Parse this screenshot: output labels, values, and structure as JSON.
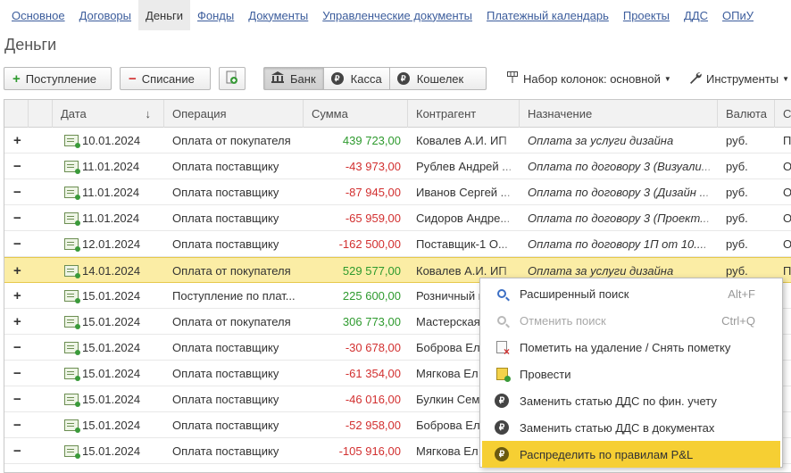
{
  "nav": {
    "items": [
      "Основное",
      "Договоры",
      "Деньги",
      "Фонды",
      "Документы",
      "Управленческие документы",
      "Платежный календарь",
      "Проекты",
      "ДДС",
      "ОПиУ"
    ],
    "active_index": 2
  },
  "page_title": "Деньги",
  "toolbar": {
    "income_label": "Поступление",
    "expense_label": "Списание",
    "bank_label": "Банк",
    "cash_label": "Касса",
    "wallet_label": "Кошелек",
    "columns_label": "Набор колонок: основной",
    "tools_label": "Инструменты",
    "active_source": "Банк"
  },
  "table": {
    "headers": {
      "date": "Дата",
      "operation": "Операция",
      "amount": "Сумма",
      "counterparty": "Контрагент",
      "purpose": "Назначение",
      "currency": "Валюта",
      "status": "Ст"
    },
    "sort_indicator": "↓",
    "rows": [
      {
        "sign": "+",
        "date": "10.01.2024",
        "operation": "Оплата от покупателя",
        "amount": "439 723,00",
        "counterparty": "Ковалев А.И. ИП",
        "purpose": "Оплата за услуги дизайна",
        "currency": "руб.",
        "status": "П"
      },
      {
        "sign": "−",
        "date": "11.01.2024",
        "operation": "Оплата поставщику",
        "amount": "-43 973,00",
        "counterparty": "Рублев Андрей ...",
        "purpose": "Оплата по договору 3 (Визуали...",
        "currency": "руб.",
        "status": "О"
      },
      {
        "sign": "−",
        "date": "11.01.2024",
        "operation": "Оплата поставщику",
        "amount": "-87 945,00",
        "counterparty": "Иванов Сергей ...",
        "purpose": "Оплата по договору 3 (Дизайн ...",
        "currency": "руб.",
        "status": "О"
      },
      {
        "sign": "−",
        "date": "11.01.2024",
        "operation": "Оплата поставщику",
        "amount": "-65 959,00",
        "counterparty": "Сидоров Андре...",
        "purpose": "Оплата по договору 3 (Проект...",
        "currency": "руб.",
        "status": "О"
      },
      {
        "sign": "−",
        "date": "12.01.2024",
        "operation": "Оплата поставщику",
        "amount": "-162 500,00",
        "counterparty": "Поставщик-1 О...",
        "purpose": "Оплата по договору 1П от 10....",
        "currency": "руб.",
        "status": "О"
      },
      {
        "sign": "+",
        "date": "14.01.2024",
        "operation": "Оплата от покупателя",
        "amount": "529 577,00",
        "counterparty": "Ковалев А.И. ИП",
        "purpose": "Оплата за услуги дизайна",
        "currency": "руб.",
        "status": "П"
      },
      {
        "sign": "+",
        "date": "15.01.2024",
        "operation": "Поступление по плат...",
        "amount": "225 600,00",
        "counterparty": "Розничный п",
        "purpose": "",
        "currency": "",
        "status": ""
      },
      {
        "sign": "+",
        "date": "15.01.2024",
        "operation": "Оплата от покупателя",
        "amount": "306 773,00",
        "counterparty": "Мастерская",
        "purpose": "",
        "currency": "",
        "status": ""
      },
      {
        "sign": "−",
        "date": "15.01.2024",
        "operation": "Оплата поставщику",
        "amount": "-30 678,00",
        "counterparty": "Боброва Ел",
        "purpose": "",
        "currency": "",
        "status": ""
      },
      {
        "sign": "−",
        "date": "15.01.2024",
        "operation": "Оплата поставщику",
        "amount": "-61 354,00",
        "counterparty": "Мягкова Ел",
        "purpose": "",
        "currency": "",
        "status": ""
      },
      {
        "sign": "−",
        "date": "15.01.2024",
        "operation": "Оплата поставщику",
        "amount": "-46 016,00",
        "counterparty": "Булкин Сем",
        "purpose": "",
        "currency": "",
        "status": ""
      },
      {
        "sign": "−",
        "date": "15.01.2024",
        "operation": "Оплата поставщику",
        "amount": "-52 958,00",
        "counterparty": "Боброва Ел",
        "purpose": "",
        "currency": "",
        "status": ""
      },
      {
        "sign": "−",
        "date": "15.01.2024",
        "operation": "Оплата поставщику",
        "amount": "-105 916,00",
        "counterparty": "Мягкова Ел",
        "purpose": "",
        "currency": "",
        "status": ""
      }
    ],
    "selected_index": 5
  },
  "context_menu": {
    "items": [
      {
        "label": "Расширенный поиск",
        "shortcut": "Alt+F",
        "icon": "search-icon",
        "disabled": false
      },
      {
        "label": "Отменить поиск",
        "shortcut": "Ctrl+Q",
        "icon": "cancel-search-icon",
        "disabled": true
      },
      {
        "label": "Пометить на удаление / Снять пометку",
        "shortcut": "",
        "icon": "mark-delete-icon",
        "disabled": false
      },
      {
        "label": "Провести",
        "shortcut": "",
        "icon": "post-icon",
        "disabled": false
      },
      {
        "label": "Заменить статью ДДС по фин. учету",
        "shortcut": "",
        "icon": "ruble-coin-icon",
        "disabled": false
      },
      {
        "label": "Заменить статью ДДС в документах",
        "shortcut": "",
        "icon": "ruble-coin-icon",
        "disabled": false
      },
      {
        "label": "Распределить по правилам P&L",
        "shortcut": "",
        "icon": "ruble-coin-icon",
        "disabled": false
      }
    ],
    "highlighted_index": 6
  },
  "colors": {
    "positive": "#2e9a2e",
    "negative": "#d23030",
    "link": "#3c5d9c",
    "selection": "#fbeda5",
    "menu_highlight": "#f6cf33"
  }
}
